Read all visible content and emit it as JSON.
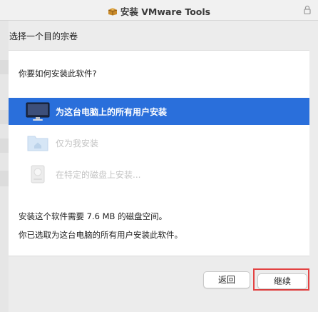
{
  "window": {
    "title": "安装 VMware Tools"
  },
  "step": {
    "title": "选择一个目的宗卷"
  },
  "panel": {
    "question": "你要如何安装此软件?",
    "options": [
      {
        "label": "为这台电脑上的所有用户安装",
        "selected": true,
        "enabled": true,
        "icon": "monitor-icon"
      },
      {
        "label": "仅为我安装",
        "selected": false,
        "enabled": false,
        "icon": "home-folder-icon"
      },
      {
        "label": "在特定的磁盘上安装...",
        "selected": false,
        "enabled": false,
        "icon": "disk-icon"
      }
    ],
    "info_line1": "安装这个软件需要 7.6 MB 的磁盘空间。",
    "info_line2": "你已选取为这台电脑的所有用户安装此软件。"
  },
  "buttons": {
    "back_label": "返回",
    "continue_label": "继续"
  },
  "colors": {
    "selection": "#2a6fdb",
    "highlight": "#e34242"
  }
}
